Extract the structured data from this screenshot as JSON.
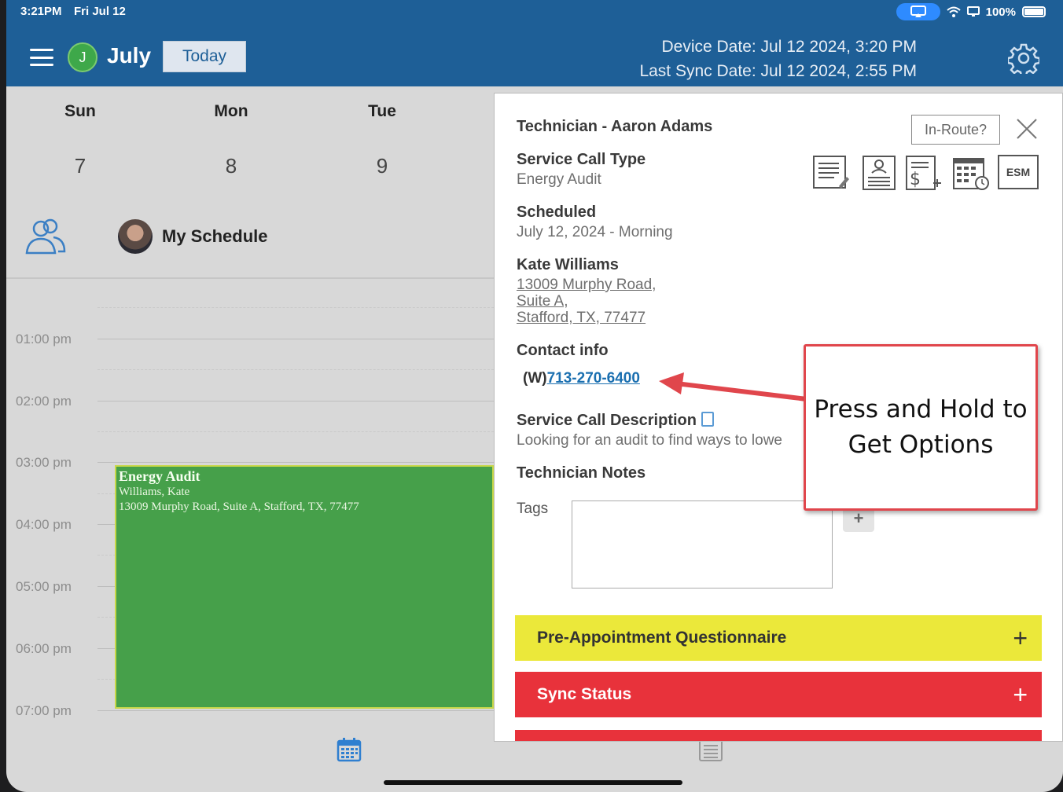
{
  "status_bar": {
    "time": "3:21PM",
    "date": "Fri Jul 12",
    "battery": "100%"
  },
  "header": {
    "user_initial": "J",
    "month": "July",
    "today_label": "Today",
    "device_date": "Device Date: Jul 12 2024, 3:20 PM",
    "last_sync": "Last Sync Date: Jul 12 2024, 2:55 PM"
  },
  "calendar": {
    "days": [
      {
        "name": "Sun",
        "num": "7"
      },
      {
        "name": "Mon",
        "num": "8"
      },
      {
        "name": "Tue",
        "num": "9"
      }
    ],
    "schedule_title": "My Schedule",
    "times": [
      "01:00 pm",
      "02:00 pm",
      "03:00 pm",
      "04:00 pm",
      "05:00 pm",
      "06:00 pm",
      "07:00 pm"
    ],
    "event": {
      "title": "Energy Audit",
      "customer": "Williams, Kate",
      "address": "13009 Murphy Road, Suite A, Stafford, TX, 77477",
      "color": "#46a04a"
    }
  },
  "detail": {
    "technician": "Technician - Aaron Adams",
    "inroute_label": "In-Route?",
    "esm_label": "ESM",
    "service_call_type_label": "Service Call Type",
    "service_call_type": "Energy Audit",
    "scheduled_label": "Scheduled",
    "scheduled": "July 12, 2024 - Morning",
    "customer_name": "Kate Williams",
    "address_line1": "13009 Murphy Road,",
    "address_line2": "Suite A,",
    "address_line3": "Stafford, TX, 77477",
    "contact_label": "Contact info",
    "phone_prefix": "(W)",
    "phone": "713-270-6400",
    "description_label": "Service Call Description",
    "description": "Looking for an audit to find ways to lowe",
    "tech_notes_label": "Technician Notes",
    "tags_label": "Tags",
    "tag_add": "+",
    "sections": [
      {
        "label": "Pre-Appointment Questionnaire",
        "color": "#ebe83a"
      },
      {
        "label": "Sync Status",
        "color": "#e8323b"
      }
    ],
    "section_expand": "+"
  },
  "callout": {
    "text_line1": "Press and Hold to",
    "text_line2": "Get Options",
    "border_color": "#e0464c"
  }
}
